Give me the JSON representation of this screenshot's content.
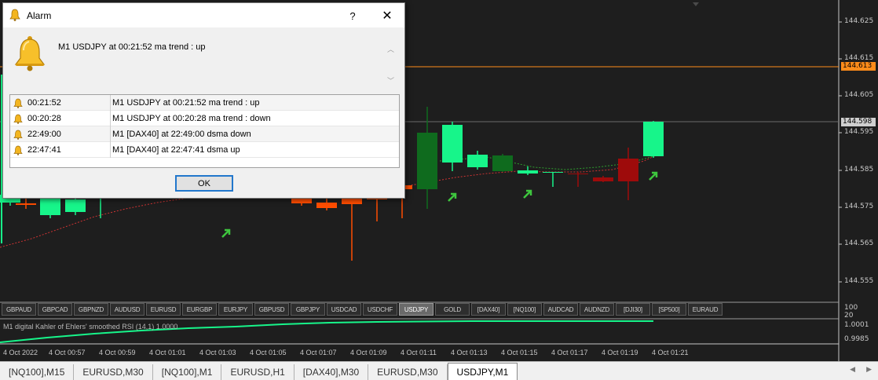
{
  "price_axis": [
    "144.625",
    "144.615",
    "144.605",
    "144.595",
    "144.585",
    "144.575",
    "144.565",
    "144.555"
  ],
  "price_tags": {
    "orange": "144.613",
    "grey": "144.598"
  },
  "colors": {
    "background": "#1e1e1e",
    "bull": "#17f58a",
    "bull_dark": "#0f6b1e",
    "bear": "#ff4d00",
    "bear_dark": "#9e0b0b",
    "orange_line": "#ff8c1a",
    "arrow_green": "#3ec63e",
    "ma_red": "#cc3333",
    "ma_green": "#2e9e2e"
  },
  "symbols": [
    {
      "label": "GBPAUD",
      "active": false
    },
    {
      "label": "GBPCAD",
      "active": false
    },
    {
      "label": "GBPNZD",
      "active": false
    },
    {
      "label": "AUDUSD",
      "active": false
    },
    {
      "label": "EURUSD",
      "active": false
    },
    {
      "label": "EURGBP",
      "active": false
    },
    {
      "label": "EURJPY",
      "active": false
    },
    {
      "label": "GBPUSD",
      "active": false
    },
    {
      "label": "GBPJPY",
      "active": false
    },
    {
      "label": "USDCAD",
      "active": false
    },
    {
      "label": "USDCHF",
      "active": false
    },
    {
      "label": "USDJPY",
      "active": true
    },
    {
      "label": "GOLD",
      "active": false
    },
    {
      "label": "[DAX40]",
      "active": false
    },
    {
      "label": "[NQ100]",
      "active": false
    },
    {
      "label": "AUDCAD",
      "active": false
    },
    {
      "label": "AUDNZD",
      "active": false
    },
    {
      "label": "[DJI30]",
      "active": false
    },
    {
      "label": "[SP500]",
      "active": false
    },
    {
      "label": "EURAUD",
      "active": false
    }
  ],
  "indicator": {
    "title": "M1 digital Kahler of Ehlers' smoothed RSI  (14,1) 1.0000",
    "levels": [
      "100",
      "20",
      "1.0001",
      "0.9985"
    ]
  },
  "time_axis": [
    "4 Oct 2022",
    "4 Oct 00:57",
    "4 Oct 00:59",
    "4 Oct 01:01",
    "4 Oct 01:03",
    "4 Oct 01:05",
    "4 Oct 01:07",
    "4 Oct 01:09",
    "4 Oct 01:11",
    "4 Oct 01:13",
    "4 Oct 01:15",
    "4 Oct 01:17",
    "4 Oct 01:19",
    "4 Oct 01:21"
  ],
  "tabs": [
    {
      "label": "[NQ100],M15",
      "active": false
    },
    {
      "label": "EURUSD,M30",
      "active": false
    },
    {
      "label": "[NQ100],M1",
      "active": false
    },
    {
      "label": "EURUSD,H1",
      "active": false
    },
    {
      "label": "[DAX40],M30",
      "active": false
    },
    {
      "label": "EURUSD,M30",
      "active": false
    },
    {
      "label": "USDJPY,M1",
      "active": true
    }
  ],
  "alarm": {
    "title": "Alarm",
    "help": "?",
    "close": "✕",
    "message": "M1 USDJPY at 00:21:52 ma trend :  up",
    "rows": [
      {
        "time": "00:21:52",
        "message": "M1 USDJPY at 00:21:52 ma trend :  up"
      },
      {
        "time": "00:20:28",
        "message": "M1 USDJPY at 00:20:28 ma trend :  down"
      },
      {
        "time": "22:49:00",
        "message": "M1 [DAX40] at 22:49:00 dsma   down"
      },
      {
        "time": "22:47:41",
        "message": "M1 [DAX40] at 22:47:41 dsma   up"
      }
    ],
    "ok_label": "OK"
  }
}
